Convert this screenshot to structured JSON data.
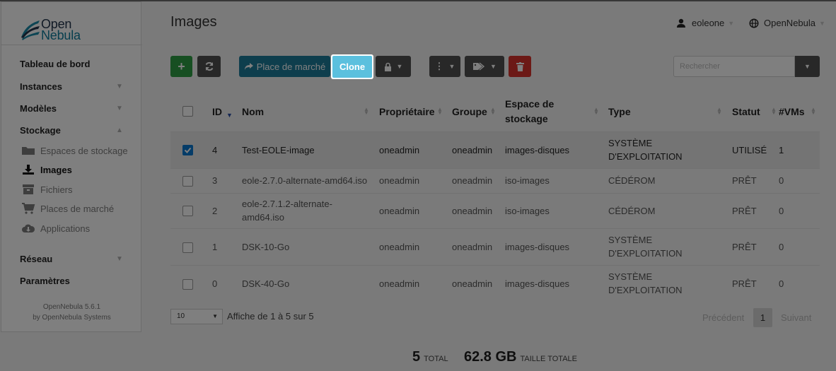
{
  "logo": {
    "line1": "Open",
    "line2": "Nebula"
  },
  "sidebar": {
    "items": [
      {
        "label": "Tableau de bord"
      },
      {
        "label": "Instances"
      },
      {
        "label": "Modèles"
      },
      {
        "label": "Stockage"
      },
      {
        "label": "Réseau"
      },
      {
        "label": "Paramètres"
      }
    ],
    "storage_items": [
      {
        "label": "Espaces de stockage",
        "icon": "folder-icon"
      },
      {
        "label": "Images",
        "icon": "download-icon"
      },
      {
        "label": "Fichiers",
        "icon": "archive-icon"
      },
      {
        "label": "Places de marché",
        "icon": "cart-icon"
      },
      {
        "label": "Applications",
        "icon": "cloud-download-icon"
      }
    ],
    "footer_version": "OpenNebula 5.6.1",
    "footer_by": "by OpenNebula Systems"
  },
  "header": {
    "title": "Images",
    "user": "eoleone",
    "zone": "OpenNebula"
  },
  "toolbar": {
    "marketplace_label": "Place de marché",
    "clone_label": "Clone",
    "search_placeholder": "Rechercher"
  },
  "table": {
    "columns": [
      "ID",
      "Nom",
      "Propriétaire",
      "Groupe",
      "Espace de stockage",
      "Type",
      "Statut",
      "#VMs"
    ],
    "rows": [
      {
        "id": "4",
        "name": "Test-EOLE-image",
        "owner": "oneadmin",
        "group": "oneadmin",
        "datastore": "images-disques",
        "type": "SYSTÈME D'EXPLOITATION",
        "status": "UTILISÉ",
        "vms": "1",
        "selected": true
      },
      {
        "id": "3",
        "name": "eole-2.7.0-alternate-amd64.iso",
        "owner": "oneadmin",
        "group": "oneadmin",
        "datastore": "iso-images",
        "type": "CÉDÉROM",
        "status": "PRÊT",
        "vms": "0",
        "selected": false
      },
      {
        "id": "2",
        "name": "eole-2.7.1.2-alternate-amd64.iso",
        "owner": "oneadmin",
        "group": "oneadmin",
        "datastore": "iso-images",
        "type": "CÉDÉROM",
        "status": "PRÊT",
        "vms": "0",
        "selected": false
      },
      {
        "id": "1",
        "name": "DSK-10-Go",
        "owner": "oneadmin",
        "group": "oneadmin",
        "datastore": "images-disques",
        "type": "SYSTÈME D'EXPLOITATION",
        "status": "PRÊT",
        "vms": "0",
        "selected": false
      },
      {
        "id": "0",
        "name": "DSK-40-Go",
        "owner": "oneadmin",
        "group": "oneadmin",
        "datastore": "images-disques",
        "type": "SYSTÈME D'EXPLOITATION",
        "status": "PRÊT",
        "vms": "0",
        "selected": false
      }
    ]
  },
  "pager": {
    "per_page": "10",
    "info": "Affiche de 1 à 5 sur 5",
    "previous": "Précédent",
    "current": "1",
    "next": "Suivant"
  },
  "totals": {
    "count": "5",
    "count_label": "TOTAL",
    "size": "62.8 GB",
    "size_label": "TAILLE TOTALE"
  },
  "colors": {
    "green": "#2e9e45",
    "teal": "#1c7d9b",
    "cyan": "#5bc0de",
    "dark": "#505050",
    "red": "#d9332d",
    "checkbox": "#0a78d0"
  }
}
